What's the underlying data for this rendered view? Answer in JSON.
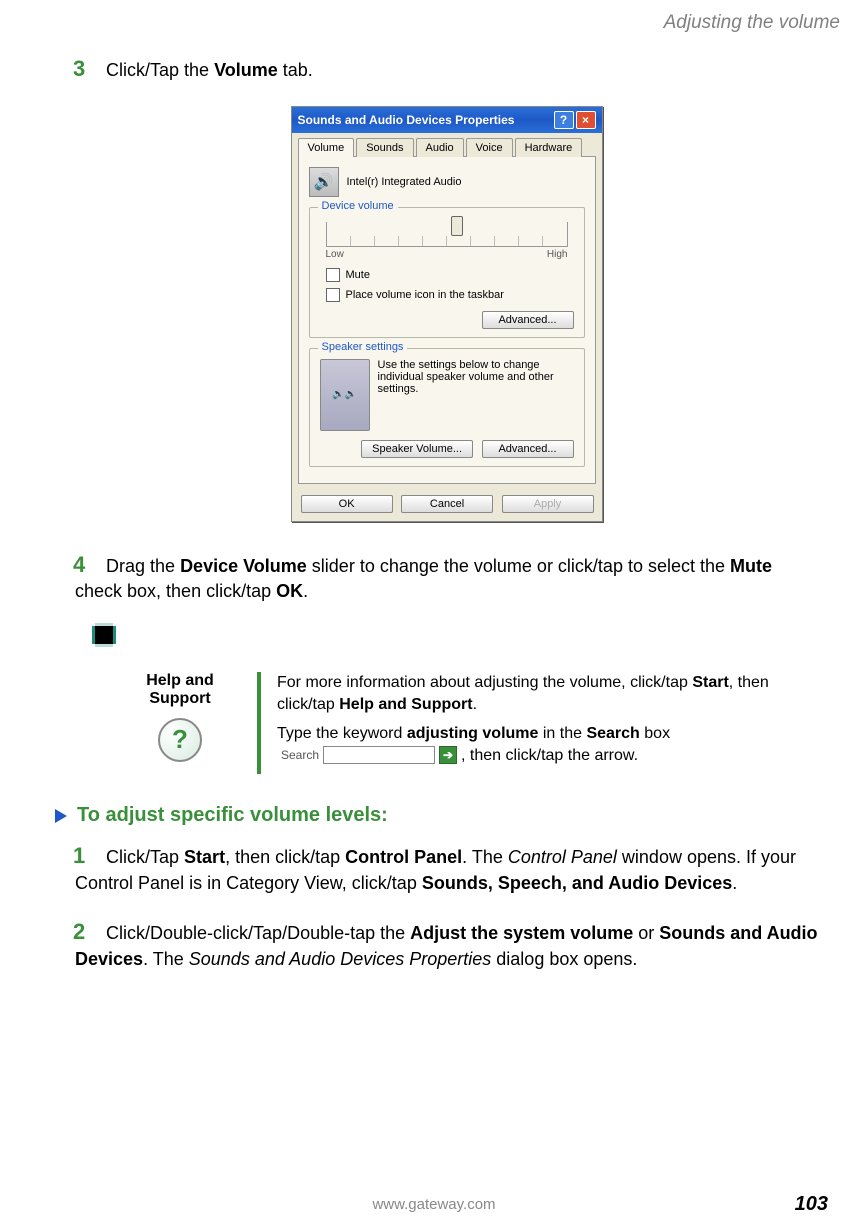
{
  "header": {
    "title": "Adjusting the volume"
  },
  "steps_a": {
    "s3": {
      "num": "3",
      "pre": "Click/Tap the ",
      "bold": "Volume",
      "post": " tab."
    },
    "s4": {
      "num": "4",
      "t1": "Drag the ",
      "b1": "Device Volume",
      "t2": " slider to change the volume or click/tap to select the ",
      "b2": "Mute",
      "t3": " check box, then click/tap ",
      "b3": "OK",
      "t4": "."
    }
  },
  "dialog": {
    "title": "Sounds and Audio Devices Properties",
    "tabs": [
      "Volume",
      "Sounds",
      "Audio",
      "Voice",
      "Hardware"
    ],
    "device_name": "Intel(r) Integrated Audio",
    "group_volume": {
      "title": "Device volume",
      "low": "Low",
      "high": "High",
      "mute": "Mute",
      "place": "Place volume icon in the taskbar",
      "advanced": "Advanced..."
    },
    "group_speaker": {
      "title": "Speaker settings",
      "desc": "Use the settings below to change individual speaker volume and other settings.",
      "spk_vol": "Speaker Volume...",
      "advanced": "Advanced..."
    },
    "buttons": {
      "ok": "OK",
      "cancel": "Cancel",
      "apply": "Apply"
    }
  },
  "help": {
    "label": "Help and Support",
    "line1a": "For more information about adjusting the volume, click/tap ",
    "line1b": "Start",
    "line1c": ", then click/tap ",
    "line1d": "Help and Support",
    "line1e": ".",
    "line2a": "Type the keyword ",
    "line2b": "adjusting volume",
    "line2c": " in the ",
    "line2d": "Search",
    "line2e": " box",
    "search_label": "Search",
    "line2f": ", then click/tap the arrow."
  },
  "section2": {
    "heading": "To adjust specific volume levels:",
    "s1": {
      "num": "1",
      "t1": "Click/Tap ",
      "b1": "Start",
      "t2": ", then click/tap ",
      "b2": "Control Panel",
      "t3": ". The ",
      "i1": "Control Panel",
      "t4": " window opens. If your Control Panel is in Category View, click/tap ",
      "b3": "Sounds, Speech, and Audio Devices",
      "t5": "."
    },
    "s2": {
      "num": "2",
      "t1": "Click/Double-click/Tap/Double-tap the ",
      "b1": "Adjust the system volume",
      "t2": " or ",
      "b2": "Sounds and Audio Devices",
      "t3": ". The ",
      "i1": "Sounds and Audio Devices Properties",
      "t4": " dialog box opens."
    }
  },
  "footer": {
    "url": "www.gateway.com",
    "page": "103"
  }
}
